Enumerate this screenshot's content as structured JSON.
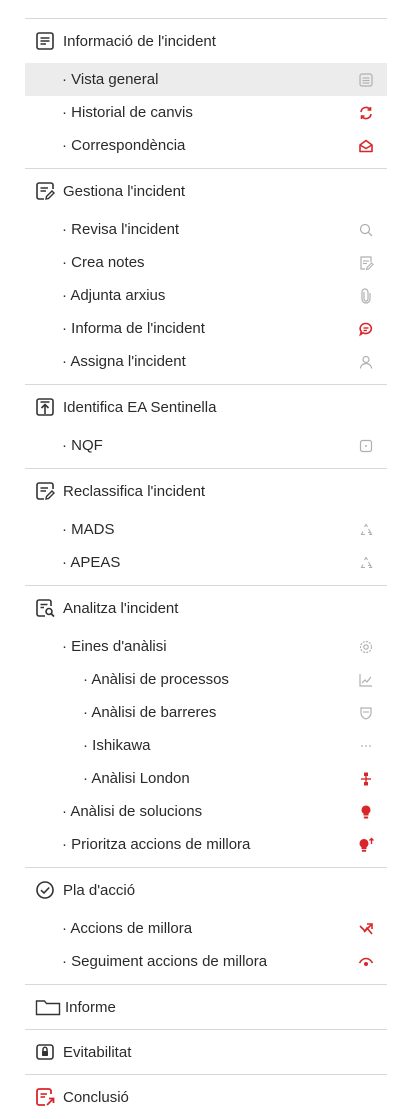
{
  "colors": {
    "red": "#d9262b",
    "grey": "#b0b0b0",
    "divider": "#d8d8d8",
    "active_bg": "#ececec"
  },
  "sections": [
    {
      "title": "Informació de l'incident",
      "icon": "document-icon",
      "items": [
        {
          "label": "· Vista general",
          "icon": "list-icon"
        },
        {
          "label": "· Historial de canvis",
          "icon": "refresh-icon"
        },
        {
          "label": "· Correspondència",
          "icon": "envelope-open-icon"
        }
      ]
    },
    {
      "title": "Gestiona l'incident",
      "icon": "edit-document-icon",
      "items": [
        {
          "label": "· Revisa l'incident",
          "icon": "search-icon"
        },
        {
          "label": "· Crea notes",
          "icon": "note-icon"
        },
        {
          "label": "· Adjunta arxius",
          "icon": "paperclip-icon"
        },
        {
          "label": "· Informa de l'incident",
          "icon": "chat-icon"
        },
        {
          "label": "· Assigna l'incident",
          "icon": "user-icon"
        }
      ]
    },
    {
      "title": "Identifica EA Sentinella",
      "icon": "upload-box-icon",
      "items": [
        {
          "label": "· NQF",
          "icon": "square-dot-icon"
        }
      ]
    },
    {
      "title": "Reclassifica l'incident",
      "icon": "edit-document-icon",
      "items": [
        {
          "label": "· MADS",
          "icon": "recycle-icon"
        },
        {
          "label": "· APEAS",
          "icon": "recycle-icon"
        }
      ]
    },
    {
      "title": "Analitza l'incident",
      "icon": "document-search-icon",
      "items": [
        {
          "label": "· Eines d'anàlisi",
          "icon": "gear-icon"
        },
        {
          "label": "· Anàlisi de processos",
          "icon": "line-chart-icon"
        },
        {
          "label": "· Anàlisi de barreres",
          "icon": "shield-icon"
        },
        {
          "label": "· Ishikawa",
          "icon": "dots-icon"
        },
        {
          "label": "· Anàlisi London",
          "icon": "org-chart-icon"
        },
        {
          "label": "· Anàlisi de solucions",
          "icon": "lightbulb-icon"
        },
        {
          "label": "· Prioritza accions de millora",
          "icon": "lightbulb-up-icon"
        }
      ]
    },
    {
      "title": "Pla d'acció",
      "icon": "check-circle-icon",
      "items": [
        {
          "label": "· Accions de millora",
          "icon": "trend-arrow-icon"
        },
        {
          "label": "· Seguiment accions de millora",
          "icon": "eye-icon"
        }
      ]
    },
    {
      "title": "Informe",
      "icon": "folder-icon",
      "items": []
    },
    {
      "title": "Evitabilitat",
      "icon": "lock-shield-icon",
      "items": []
    },
    {
      "title": "Conclusió",
      "icon": "export-document-icon",
      "items": []
    }
  ]
}
